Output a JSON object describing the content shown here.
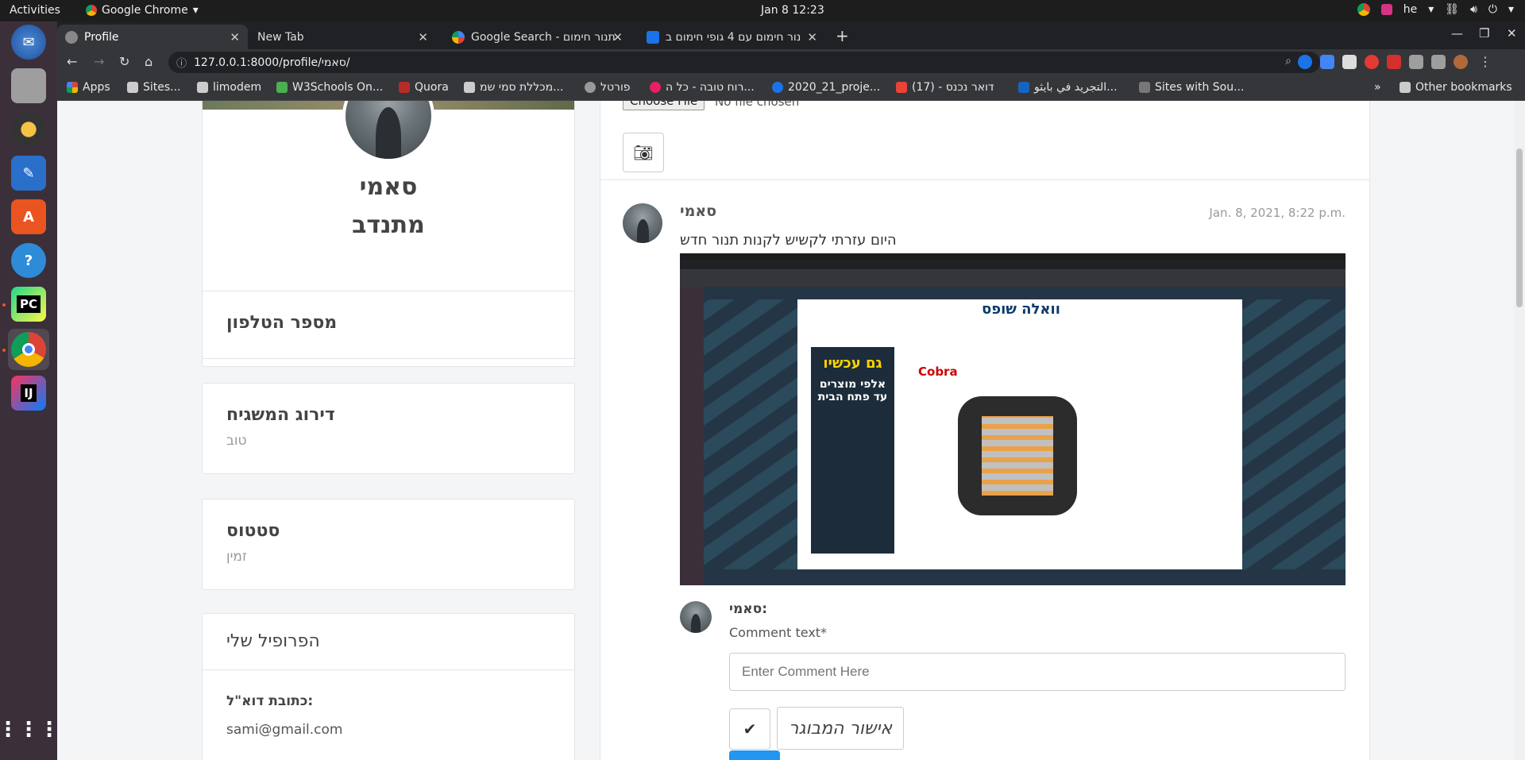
{
  "topbar": {
    "activities": "Activities",
    "app": "Google Chrome",
    "clock": "Jan 8  12:23",
    "lang": "he"
  },
  "tabs": [
    {
      "label": "Profile"
    },
    {
      "label": "New Tab"
    },
    {
      "label": "Google Search - תנור חימום"
    },
    {
      "label": "תנור חימום עם 4 גופי חימום ב"
    }
  ],
  "address": {
    "url": "127.0.0.1:8000/profile/סאמי/"
  },
  "bookmarks": {
    "apps": "Apps",
    "items": [
      "Sites...",
      "limodem",
      "W3Schools On...",
      "Quora",
      "מכללת סמי שמ...",
      "פורטל",
      "רוח טובה - כל ה...",
      "2020_21_proje...",
      "דואר נכנס - (17)",
      "التجريد في بايثو...",
      "Sites with Sou..."
    ],
    "other": "Other bookmarks"
  },
  "profile": {
    "name": "סאמי",
    "role": "מתנדב"
  },
  "phone_card": {
    "title": "מספר הטלפון"
  },
  "rating_card": {
    "title": "דירוג המשגיח",
    "value": "טוב"
  },
  "status_card": {
    "title": "סטטוס",
    "value": "זמין"
  },
  "my_profile": {
    "title": "הפרופיל שלי",
    "email_label": "כתובת דוא\"ל:",
    "email": "sami@gmail.com"
  },
  "upload": {
    "choose": "Choose File",
    "no_file": "No file chosen"
  },
  "post": {
    "author": "סאמי",
    "date": "Jan. 8, 2021, 8:22 p.m.",
    "text": "היום עזרתי לקשיש לקנות תנור חדש",
    "image_alt": "screenshot of walla shops heater page"
  },
  "comment_form": {
    "author": "סאמי:",
    "label": "Comment text*",
    "placeholder": "Enter Comment Here",
    "approve": "אישור המבוגר"
  },
  "post_image_text": {
    "site_logo": "וואלה שופס",
    "brand": "Cobra",
    "promo": "גם עכשיו",
    "promo_sub": "אלפי מוצרים עד פתח הבית"
  }
}
